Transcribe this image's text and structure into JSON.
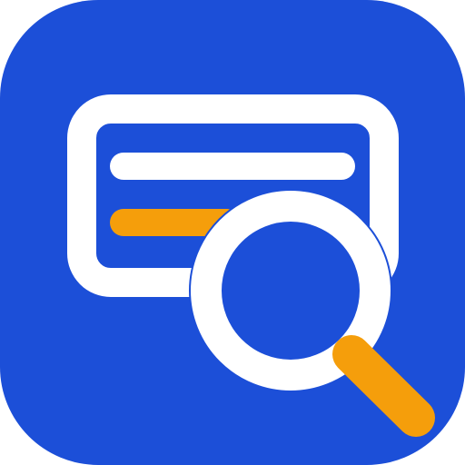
{
  "icon": {
    "name": "credit-card-search-icon",
    "background_color": "#1C4FD8",
    "stroke_color": "#FFFFFF",
    "accent_color": "#F59E0B"
  }
}
